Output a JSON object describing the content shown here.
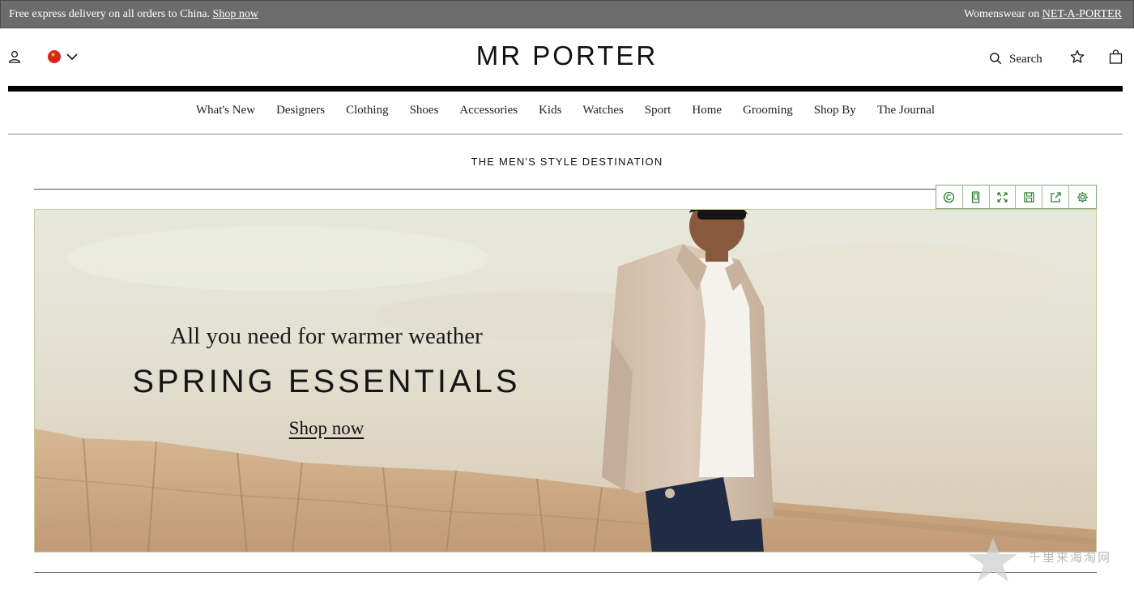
{
  "promo_bar": {
    "message": "Free express delivery on all orders to China.",
    "message_link": "Shop now",
    "womenswear_prefix": "Womenswear on",
    "womenswear_link": "NET-A-PORTER"
  },
  "header": {
    "logo": "MR PORTER",
    "search_label": "Search",
    "icons": [
      "account-icon",
      "china-flag-icon",
      "chevron-down-icon",
      "search-icon",
      "star-icon",
      "shopping-bag-icon"
    ]
  },
  "nav": {
    "items": [
      "What's New",
      "Designers",
      "Clothing",
      "Shoes",
      "Accessories",
      "Kids",
      "Watches",
      "Sport",
      "Home",
      "Grooming",
      "Shop By",
      "The Journal"
    ]
  },
  "tagline": "THE MEN'S STYLE DESTINATION",
  "hero": {
    "subtitle": "All you need for warmer weather",
    "title": "SPRING ESSENTIALS",
    "cta": "Shop now"
  },
  "capture_toolbar": {
    "tools": [
      "copyright-icon",
      "phone-icon",
      "fullscreen-icon",
      "save-icon",
      "share-icon",
      "settings-icon"
    ]
  },
  "watermark": {
    "text": "千里来海淘网"
  },
  "colors": {
    "promo_bg": "#6c6c6c",
    "rule": "#000000",
    "toolbar_green": "#2e7d32",
    "hero_sky": "#e4e1d2",
    "rock": "#cfae8a"
  }
}
